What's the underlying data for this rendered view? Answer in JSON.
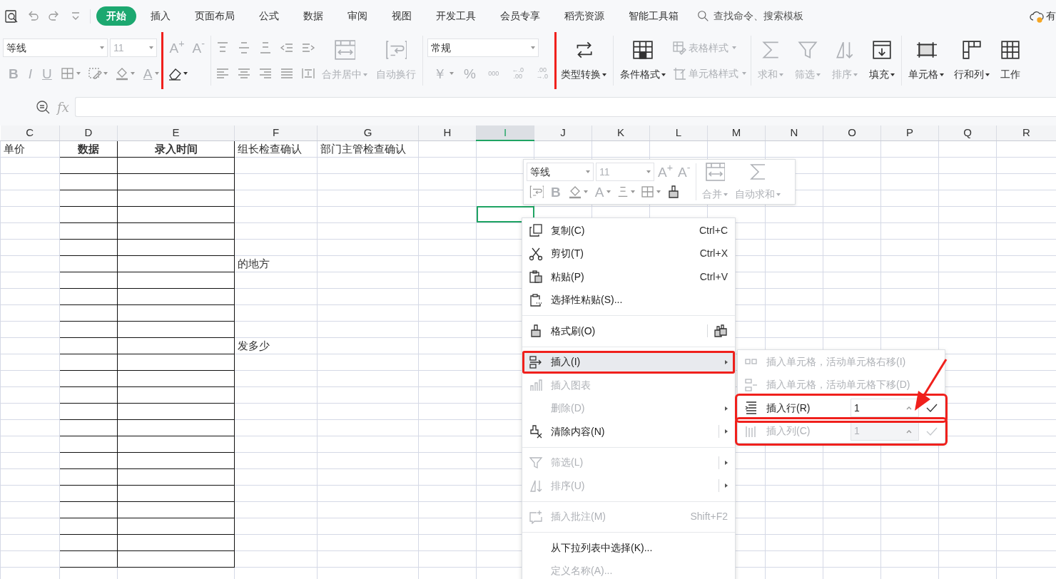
{
  "tabs": [
    {
      "label": "开始",
      "selected": true
    },
    {
      "label": "插入",
      "selected": false
    },
    {
      "label": "页面布局",
      "selected": false
    },
    {
      "label": "公式",
      "selected": false
    },
    {
      "label": "数据",
      "selected": false
    },
    {
      "label": "审阅",
      "selected": false
    },
    {
      "label": "视图",
      "selected": false
    },
    {
      "label": "开发工具",
      "selected": false
    },
    {
      "label": "会员专享",
      "selected": false
    },
    {
      "label": "稻壳资源",
      "selected": false
    },
    {
      "label": "智能工具箱",
      "selected": false
    }
  ],
  "search": {
    "placeholder": "查找命令、搜索模板"
  },
  "account": {
    "label": "有"
  },
  "ribbon": {
    "font_name": "等线",
    "font_size": {
      "value": "11",
      "disabled": true
    },
    "style_glyphs": [
      {
        "glyph": "B",
        "disabled": true
      },
      {
        "glyph": "I",
        "disabled": true
      },
      {
        "glyph": "U",
        "disabled": true
      }
    ],
    "color_glyph": {
      "glyph": "A",
      "disabled": true
    },
    "size_glyphs": [
      {
        "glyph": "A$^{+}$",
        "disabled": true
      },
      {
        "glyph": "A$^{-}$",
        "disabled": true
      }
    ],
    "number_format": "常规",
    "number_glyphs": [
      {
        "glyph": "￥",
        "disabled": true,
        "dropdown": true
      },
      {
        "glyph": "%",
        "disabled": true,
        "dropdown": false
      },
      {
        "glyph": "000",
        "disabled": true,
        "dropdown": false
      },
      {
        "glyph": "←.0 .00",
        "disabled": true,
        "dropdown": false
      },
      {
        "glyph": ".00 →.0",
        "disabled": true,
        "dropdown": false
      }
    ],
    "highlighted": true,
    "buttons": [
      {
        "label": "合并居中",
        "disabled": true,
        "dropdown": true
      },
      {
        "label": "自动换行",
        "disabled": true,
        "dropdown": false
      },
      {
        "label": "类型转换",
        "disabled": false,
        "dropdown": true
      },
      {
        "label": "条件格式",
        "disabled": false,
        "dropdown": true
      },
      {
        "label": "表格样式",
        "disabled": true,
        "dropdown": true
      },
      {
        "label": "单元格样式",
        "disabled": true,
        "dropdown": true
      },
      {
        "label": "求和",
        "disabled": true,
        "dropdown": true
      },
      {
        "label": "筛选",
        "disabled": true,
        "dropdown": true
      },
      {
        "label": "排序",
        "disabled": true,
        "dropdown": true
      },
      {
        "label": "填充",
        "disabled": false,
        "dropdown": true
      },
      {
        "label": "单元格",
        "disabled": false,
        "dropdown": true
      },
      {
        "label": "行和列",
        "disabled": false,
        "dropdown": true
      },
      {
        "label": "工作",
        "disabled": false,
        "dropdown": false
      }
    ]
  },
  "formula_bar": {
    "fx_label": "fx"
  },
  "sheet": {
    "columns": [
      {
        "label": "C",
        "selected": false
      },
      {
        "label": "D",
        "selected": false
      },
      {
        "label": "E",
        "selected": false
      },
      {
        "label": "F",
        "selected": false
      },
      {
        "label": "G",
        "selected": false
      },
      {
        "label": "H",
        "selected": false
      },
      {
        "label": "I",
        "selected": true
      },
      {
        "label": "J",
        "selected": false
      },
      {
        "label": "K",
        "selected": false
      },
      {
        "label": "L",
        "selected": false
      },
      {
        "label": "M",
        "selected": false
      },
      {
        "label": "N",
        "selected": false
      },
      {
        "label": "O",
        "selected": false
      },
      {
        "label": "P",
        "selected": false
      },
      {
        "label": "Q",
        "selected": false
      },
      {
        "label": "R",
        "selected": false
      }
    ],
    "rows": [
      {
        "bordered": true,
        "cells": {
          "C": {
            "text": "单价",
            "bold": false,
            "centered": false,
            "selected": false
          },
          "D": {
            "text": "数据",
            "bold": true,
            "centered": true,
            "selected": false
          },
          "E": {
            "text": "录入时间",
            "bold": true,
            "centered": true,
            "selected": false
          },
          "F": {
            "text": "组长检查确认",
            "bold": false,
            "centered": false,
            "selected": false
          },
          "G": {
            "text": "部门主管检查确认",
            "bold": false,
            "centered": false,
            "selected": false
          }
        }
      },
      {
        "bordered": true
      },
      {
        "bordered": true
      },
      {
        "bordered": true
      },
      {
        "bordered": true,
        "cells": {
          "I": {
            "selected": true
          }
        }
      },
      {
        "bordered": true
      },
      {
        "bordered": true
      },
      {
        "bordered": true,
        "cells": {
          "F": {
            "text": "的地方",
            "bold": false,
            "centered": false,
            "selected": false
          }
        }
      },
      {
        "bordered": true
      },
      {
        "bordered": true
      },
      {
        "bordered": true
      },
      {
        "bordered": true
      },
      {
        "bordered": true,
        "cells": {
          "F": {
            "text": "发多少",
            "bold": false,
            "centered": false,
            "selected": false
          }
        }
      },
      {
        "bordered": true
      },
      {
        "bordered": true
      },
      {
        "bordered": true
      },
      {
        "bordered": true
      },
      {
        "bordered": true
      },
      {
        "bordered": true
      },
      {
        "bordered": true
      },
      {
        "bordered": true
      },
      {
        "bordered": true
      },
      {
        "bordered": true
      },
      {
        "bordered": true
      },
      {
        "bordered": true
      },
      {
        "bordered": true
      },
      {
        "bordered": false
      }
    ]
  },
  "mini_toolbar": {
    "font_name": "等线",
    "font_size": {
      "value": "11",
      "disabled": true
    },
    "size_glyphs": [
      {
        "glyph": "A$^{+}$",
        "disabled": true
      },
      {
        "glyph": "A$^{-}$",
        "disabled": true
      }
    ],
    "bold_glyph": {
      "glyph": "B",
      "disabled": true
    },
    "color_glyph": {
      "glyph": "A",
      "disabled": true
    },
    "buttons": [
      {
        "label": "合并",
        "disabled": true,
        "dropdown": true
      },
      {
        "label": "自动求和",
        "disabled": true,
        "dropdown": true
      }
    ]
  },
  "context_menu": {
    "items": [
      {
        "kind": "item",
        "label": "复制(C)",
        "shortcut": "Ctrl+C",
        "disabled": false,
        "submenu": false,
        "selected": false,
        "highlighted": false
      },
      {
        "kind": "item",
        "label": "剪切(T)",
        "shortcut": "Ctrl+X",
        "disabled": false,
        "submenu": false,
        "selected": false,
        "highlighted": false
      },
      {
        "kind": "item",
        "label": "粘贴(P)",
        "shortcut": "Ctrl+V",
        "disabled": false,
        "submenu": false,
        "selected": false,
        "highlighted": false
      },
      {
        "kind": "item",
        "label": "选择性粘贴(S)...",
        "disabled": false,
        "submenu": false,
        "selected": false,
        "highlighted": false
      },
      {
        "kind": "separator"
      },
      {
        "kind": "split",
        "label": "格式刷(O)",
        "disabled": false,
        "submenu": false,
        "selected": false,
        "highlighted": false
      },
      {
        "kind": "separator"
      },
      {
        "kind": "item",
        "label": "插入(I)",
        "disabled": false,
        "submenu": true,
        "selected": true,
        "highlighted": true
      },
      {
        "kind": "item",
        "label": "插入图表",
        "disabled": true,
        "submenu": false,
        "selected": false,
        "highlighted": false
      },
      {
        "kind": "item",
        "label": "删除(D)",
        "disabled": true,
        "submenu": true,
        "selected": false,
        "highlighted": false
      },
      {
        "kind": "split",
        "label": "清除内容(N)",
        "disabled": false,
        "submenu": true,
        "selected": false,
        "highlighted": false
      },
      {
        "kind": "separator"
      },
      {
        "kind": "split",
        "label": "筛选(L)",
        "disabled": true,
        "submenu": true,
        "selected": false,
        "highlighted": false
      },
      {
        "kind": "split",
        "label": "排序(U)",
        "disabled": true,
        "submenu": true,
        "selected": false,
        "highlighted": false
      },
      {
        "kind": "separator"
      },
      {
        "kind": "item",
        "label": "插入批注(M)",
        "shortcut": "Shift+F2",
        "disabled": true,
        "submenu": false,
        "selected": false,
        "highlighted": false
      },
      {
        "kind": "separator"
      },
      {
        "kind": "item",
        "label": "从下拉列表中选择(K)...",
        "disabled": false,
        "submenu": false,
        "selected": false,
        "highlighted": false
      },
      {
        "kind": "item",
        "label": "定义名称(A)...",
        "disabled": true,
        "submenu": false,
        "selected": false,
        "highlighted": false
      }
    ]
  },
  "submenu": {
    "annotation_arrow": true,
    "items": [
      {
        "kind": "item",
        "label": "插入单元格，活动单元格右移(I)",
        "disabled": true,
        "highlighted": false
      },
      {
        "kind": "item",
        "label": "插入单元格，活动单元格下移(D)",
        "disabled": true,
        "highlighted": false
      },
      {
        "kind": "spinner",
        "label": "插入行(R)",
        "value": "1",
        "disabled": false,
        "highlighted": true
      },
      {
        "kind": "spinner",
        "label": "插入列(C)",
        "value": "1",
        "disabled": true,
        "highlighted": true
      }
    ]
  }
}
